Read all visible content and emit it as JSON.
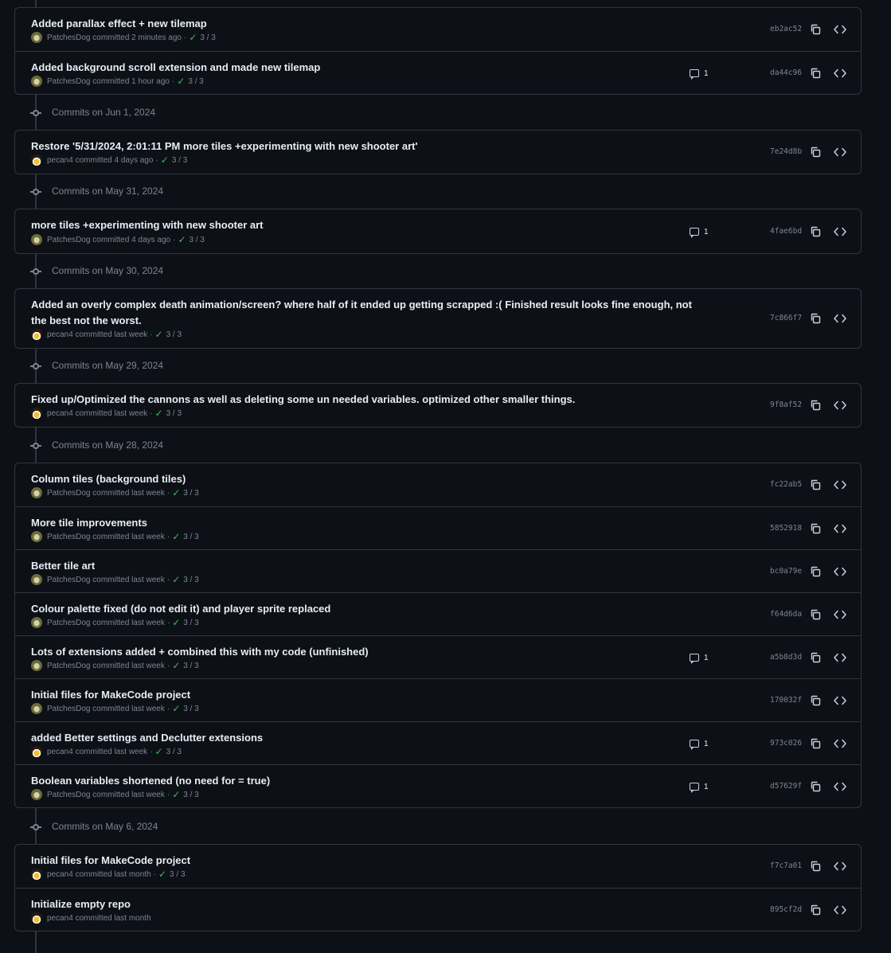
{
  "groups": [
    {
      "date": "",
      "commits": [
        {
          "title": "Added parallax effect + new tilemap",
          "author": "PatchesDog",
          "avatar": "dog",
          "time": "committed 2 minutes ago",
          "checks": "3 / 3",
          "comments": "",
          "sha": "eb2ac52"
        },
        {
          "title": "Added background scroll extension and made new tilemap",
          "author": "PatchesDog",
          "avatar": "dog",
          "time": "committed 1 hour ago",
          "checks": "3 / 3",
          "comments": "1",
          "sha": "da44c96"
        }
      ]
    },
    {
      "date": "Commits on Jun 1, 2024",
      "commits": [
        {
          "title": "Restore '5/31/2024, 2:01:11 PM more tiles +experimenting with new shooter art'",
          "author": "pecan4",
          "avatar": "pecan",
          "time": "committed 4 days ago",
          "checks": "3 / 3",
          "comments": "",
          "sha": "7e24d8b"
        }
      ]
    },
    {
      "date": "Commits on May 31, 2024",
      "commits": [
        {
          "title": "more tiles +experimenting with new shooter art",
          "author": "PatchesDog",
          "avatar": "dog",
          "time": "committed 4 days ago",
          "checks": "3 / 3",
          "comments": "1",
          "sha": "4fae6bd"
        }
      ]
    },
    {
      "date": "Commits on May 30, 2024",
      "commits": [
        {
          "title": "Added an overly complex death animation/screen? where half of it ended up getting scrapped :( Finished result looks fine enough, not the best not the worst.",
          "author": "pecan4",
          "avatar": "pecan",
          "time": "committed last week",
          "checks": "3 / 3",
          "comments": "",
          "sha": "7c866f7"
        }
      ]
    },
    {
      "date": "Commits on May 29, 2024",
      "commits": [
        {
          "title": "Fixed up/Optimized the cannons as well as deleting some un needed variables. optimized other smaller things.",
          "author": "pecan4",
          "avatar": "pecan",
          "time": "committed last week",
          "checks": "3 / 3",
          "comments": "",
          "sha": "9f8af52"
        }
      ]
    },
    {
      "date": "Commits on May 28, 2024",
      "commits": [
        {
          "title": "Column tiles (background tiles)",
          "author": "PatchesDog",
          "avatar": "dog",
          "time": "committed last week",
          "checks": "3 / 3",
          "comments": "",
          "sha": "fc22ab5"
        },
        {
          "title": "More tile improvements",
          "author": "PatchesDog",
          "avatar": "dog",
          "time": "committed last week",
          "checks": "3 / 3",
          "comments": "",
          "sha": "5852918"
        },
        {
          "title": "Better tile art",
          "author": "PatchesDog",
          "avatar": "dog",
          "time": "committed last week",
          "checks": "3 / 3",
          "comments": "",
          "sha": "bc0a79e"
        },
        {
          "title": "Colour palette fixed (do not edit it) and player sprite replaced",
          "author": "PatchesDog",
          "avatar": "dog",
          "time": "committed last week",
          "checks": "3 / 3",
          "comments": "",
          "sha": "f64d6da"
        },
        {
          "title": "Lots of extensions added + combined this with my code (unfinished)",
          "author": "PatchesDog",
          "avatar": "dog",
          "time": "committed last week",
          "checks": "3 / 3",
          "comments": "1",
          "sha": "a5b8d3d"
        },
        {
          "title": "Initial files for MakeCode project",
          "author": "PatchesDog",
          "avatar": "dog",
          "time": "committed last week",
          "checks": "3 / 3",
          "comments": "",
          "sha": "170032f"
        },
        {
          "title": "added Better settings and Declutter extensions",
          "author": "pecan4",
          "avatar": "pecan",
          "time": "committed last week",
          "checks": "3 / 3",
          "comments": "1",
          "sha": "973c026"
        },
        {
          "title": "Boolean variables shortened (no need for = true)",
          "author": "PatchesDog",
          "avatar": "dog",
          "time": "committed last week",
          "checks": "3 / 3",
          "comments": "1",
          "sha": "d57629f"
        }
      ]
    },
    {
      "date": "Commits on May 6, 2024",
      "commits": [
        {
          "title": "Initial files for MakeCode project",
          "author": "pecan4",
          "avatar": "pecan",
          "time": "committed last month",
          "checks": "3 / 3",
          "comments": "",
          "sha": "f7c7a01"
        },
        {
          "title": "Initialize empty repo",
          "author": "pecan4",
          "avatar": "pecan",
          "time": "committed last month",
          "checks": "",
          "comments": "",
          "sha": "895cf2d"
        }
      ]
    }
  ],
  "icons": {
    "check": "check-icon",
    "comment": "comment-icon",
    "copy": "copy-icon",
    "browse": "code-icon",
    "date_node": "git-commit-icon"
  },
  "colors": {
    "background": "#0d1117",
    "border": "#30363d",
    "muted": "#7d8590",
    "text": "#e6edf3",
    "success": "#3fb950"
  }
}
